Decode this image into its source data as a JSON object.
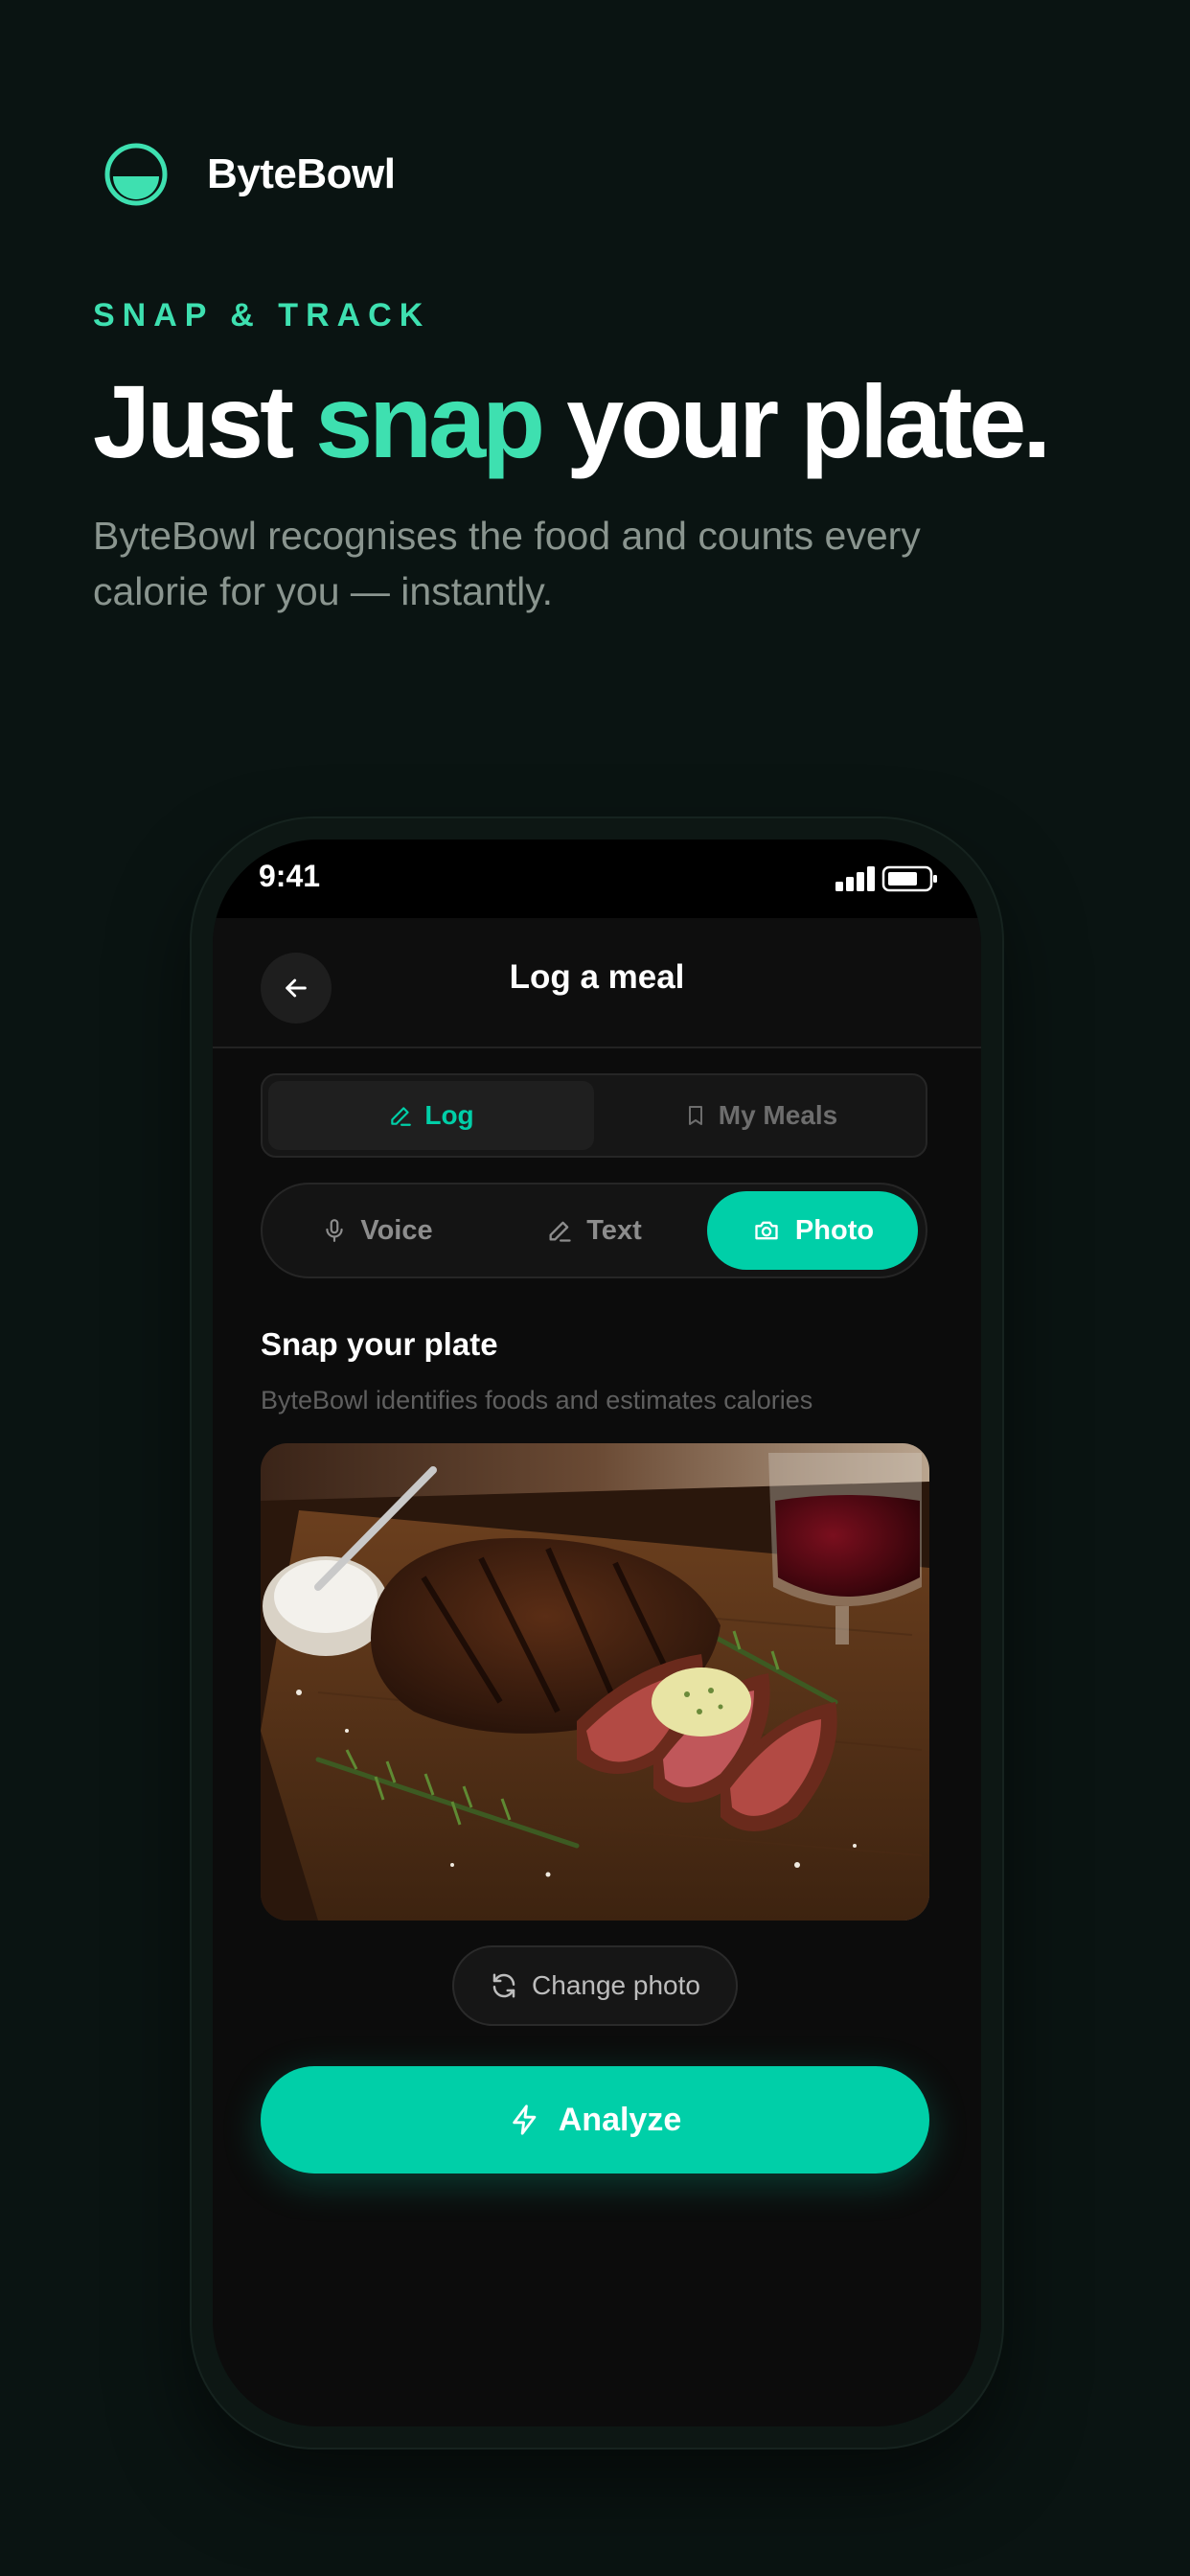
{
  "colors": {
    "accent": "#00cfa8",
    "headline_accent": "#3ee0b0",
    "background": "#0a1412"
  },
  "brand": {
    "name": "ByteBowl",
    "logo_icon": "half-bowl-icon"
  },
  "hero": {
    "eyebrow": "SNAP & TRACK",
    "headline_before": "Just ",
    "headline_accent": "snap",
    "headline_after": " your plate.",
    "subtitle": "ByteBowl recognises the food and counts every calorie for you — instantly."
  },
  "phone": {
    "status_time": "9:41",
    "app_title": "Log a meal",
    "tabs": [
      {
        "label": "Log",
        "icon": "pencil-icon",
        "selected": true
      },
      {
        "label": "My Meals",
        "icon": "bookmark-icon",
        "selected": false
      }
    ],
    "modes": [
      {
        "label": "Voice",
        "icon": "mic-icon",
        "selected": false
      },
      {
        "label": "Text",
        "icon": "pencil-icon",
        "selected": false
      },
      {
        "label": "Photo",
        "icon": "camera-icon",
        "selected": true
      }
    ],
    "section_title": "Snap your plate",
    "section_subtitle": "ByteBowl identifies foods and estimates calories",
    "change_photo_label": "Change photo",
    "analyze_label": "Analyze"
  }
}
